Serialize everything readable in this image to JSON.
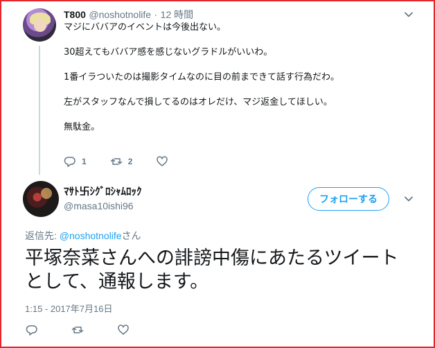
{
  "parent_tweet": {
    "name": "T800",
    "handle": "@noshotnolife",
    "separator": "·",
    "time": "12 時間",
    "lines": [
      "マジにババアのイベントは今後出ない。",
      "30超えてもババア感を感じないグラドルがいいわ。",
      "1番イラついたのは撮影タイムなのに目の前まできて話す行為だわ。",
      "左がスタッフなんで損してるのはオレだけ、マジ返金してほしい。",
      "無駄金。"
    ],
    "reply_count": "1",
    "retweet_count": "2"
  },
  "main_tweet": {
    "name": "ﾏｻﾄ卐ｼｸﾞﾛｼｬﾑﾛｯｸ",
    "handle": "@masa10ishi96",
    "follow_label": "フォローする",
    "reply_prefix": "返信先: ",
    "reply_target": "@noshotnolife",
    "reply_suffix": "さん",
    "text_lines": [
      "平塚奈菜さんへの誹謗中傷にあたるツイート",
      "として、通報します。"
    ],
    "timestamp": "1:15 - 2017年7月16日"
  },
  "colors": {
    "frame": "#e3262c",
    "accent": "#1da1f2",
    "muted": "#657786",
    "thread_line": "#ccd6dd"
  },
  "icons": {
    "reply": "reply-icon",
    "retweet": "retweet-icon",
    "like": "heart-icon",
    "menu": "chevron-down-icon"
  }
}
